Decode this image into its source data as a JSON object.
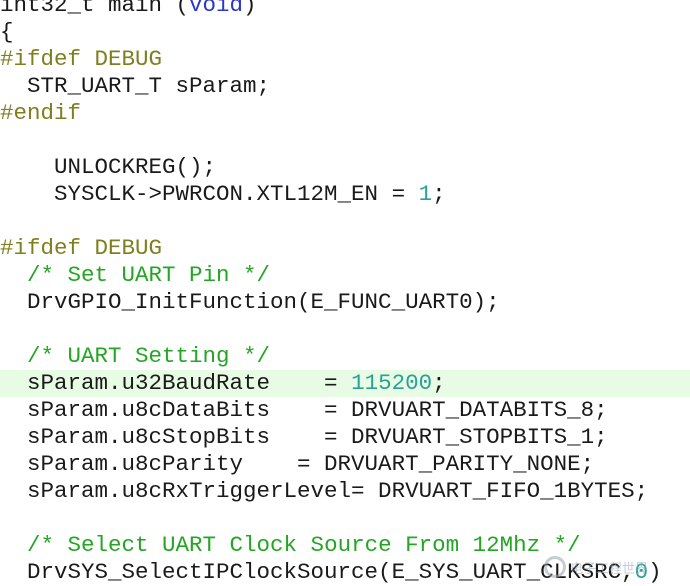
{
  "code": {
    "lines": [
      {
        "segments": [
          {
            "t": "int32_t main (",
            "c": "tx"
          },
          {
            "t": "void",
            "c": "kw"
          },
          {
            "t": ")",
            "c": "tx"
          }
        ]
      },
      {
        "segments": [
          {
            "t": "{",
            "c": "tx"
          }
        ]
      },
      {
        "segments": [
          {
            "t": "#ifdef DEBUG",
            "c": "pp"
          }
        ]
      },
      {
        "segments": [
          {
            "t": "  STR_UART_T sParam;",
            "c": "tx"
          }
        ]
      },
      {
        "segments": [
          {
            "t": "#endif",
            "c": "pp"
          }
        ]
      },
      {
        "segments": []
      },
      {
        "segments": [
          {
            "t": "    UNLOCKREG();",
            "c": "tx"
          }
        ]
      },
      {
        "segments": [
          {
            "t": "    SYSCLK->PWRCON.XTL12M_EN = ",
            "c": "tx"
          },
          {
            "t": "1",
            "c": "num"
          },
          {
            "t": ";",
            "c": "tx"
          }
        ]
      },
      {
        "segments": []
      },
      {
        "segments": [
          {
            "t": "#ifdef DEBUG",
            "c": "pp"
          }
        ]
      },
      {
        "segments": [
          {
            "t": "  ",
            "c": "tx"
          },
          {
            "t": "/* Set UART Pin */",
            "c": "cm"
          }
        ]
      },
      {
        "segments": [
          {
            "t": "  DrvGPIO_InitFunction(E_FUNC_UART0);",
            "c": "tx"
          }
        ]
      },
      {
        "segments": []
      },
      {
        "segments": [
          {
            "t": "  ",
            "c": "tx"
          },
          {
            "t": "/* UART Setting */",
            "c": "cm"
          }
        ]
      },
      {
        "segments": [
          {
            "t": "  sParam.u32BaudRate    = ",
            "c": "tx"
          },
          {
            "t": "115200",
            "c": "num"
          },
          {
            "t": ";",
            "c": "tx"
          }
        ],
        "highlight": true
      },
      {
        "segments": [
          {
            "t": "  sParam.u8cDataBits    = DRVUART_DATABITS_8;",
            "c": "tx"
          }
        ]
      },
      {
        "segments": [
          {
            "t": "  sParam.u8cStopBits    = DRVUART_STOPBITS_1;",
            "c": "tx"
          }
        ]
      },
      {
        "segments": [
          {
            "t": "  sParam.u8cParity    = DRVUART_PARITY_NONE;",
            "c": "tx"
          }
        ]
      },
      {
        "segments": [
          {
            "t": "  sParam.u8cRxTriggerLevel= DRVUART_FIFO_1BYTES;",
            "c": "tx"
          }
        ]
      },
      {
        "segments": []
      },
      {
        "segments": [
          {
            "t": "  ",
            "c": "tx"
          },
          {
            "t": "/* Select UART Clock Source From 12Mhz */",
            "c": "cm"
          }
        ]
      },
      {
        "segments": [
          {
            "t": "  DrvSYS_SelectIPClockSource(E_SYS_UART_CLKSRC,",
            "c": "tx"
          },
          {
            "t": "0",
            "c": "num"
          },
          {
            "t": ")",
            "c": "tx"
          }
        ]
      }
    ]
  },
  "watermark": {
    "text": "电子工程世界"
  }
}
